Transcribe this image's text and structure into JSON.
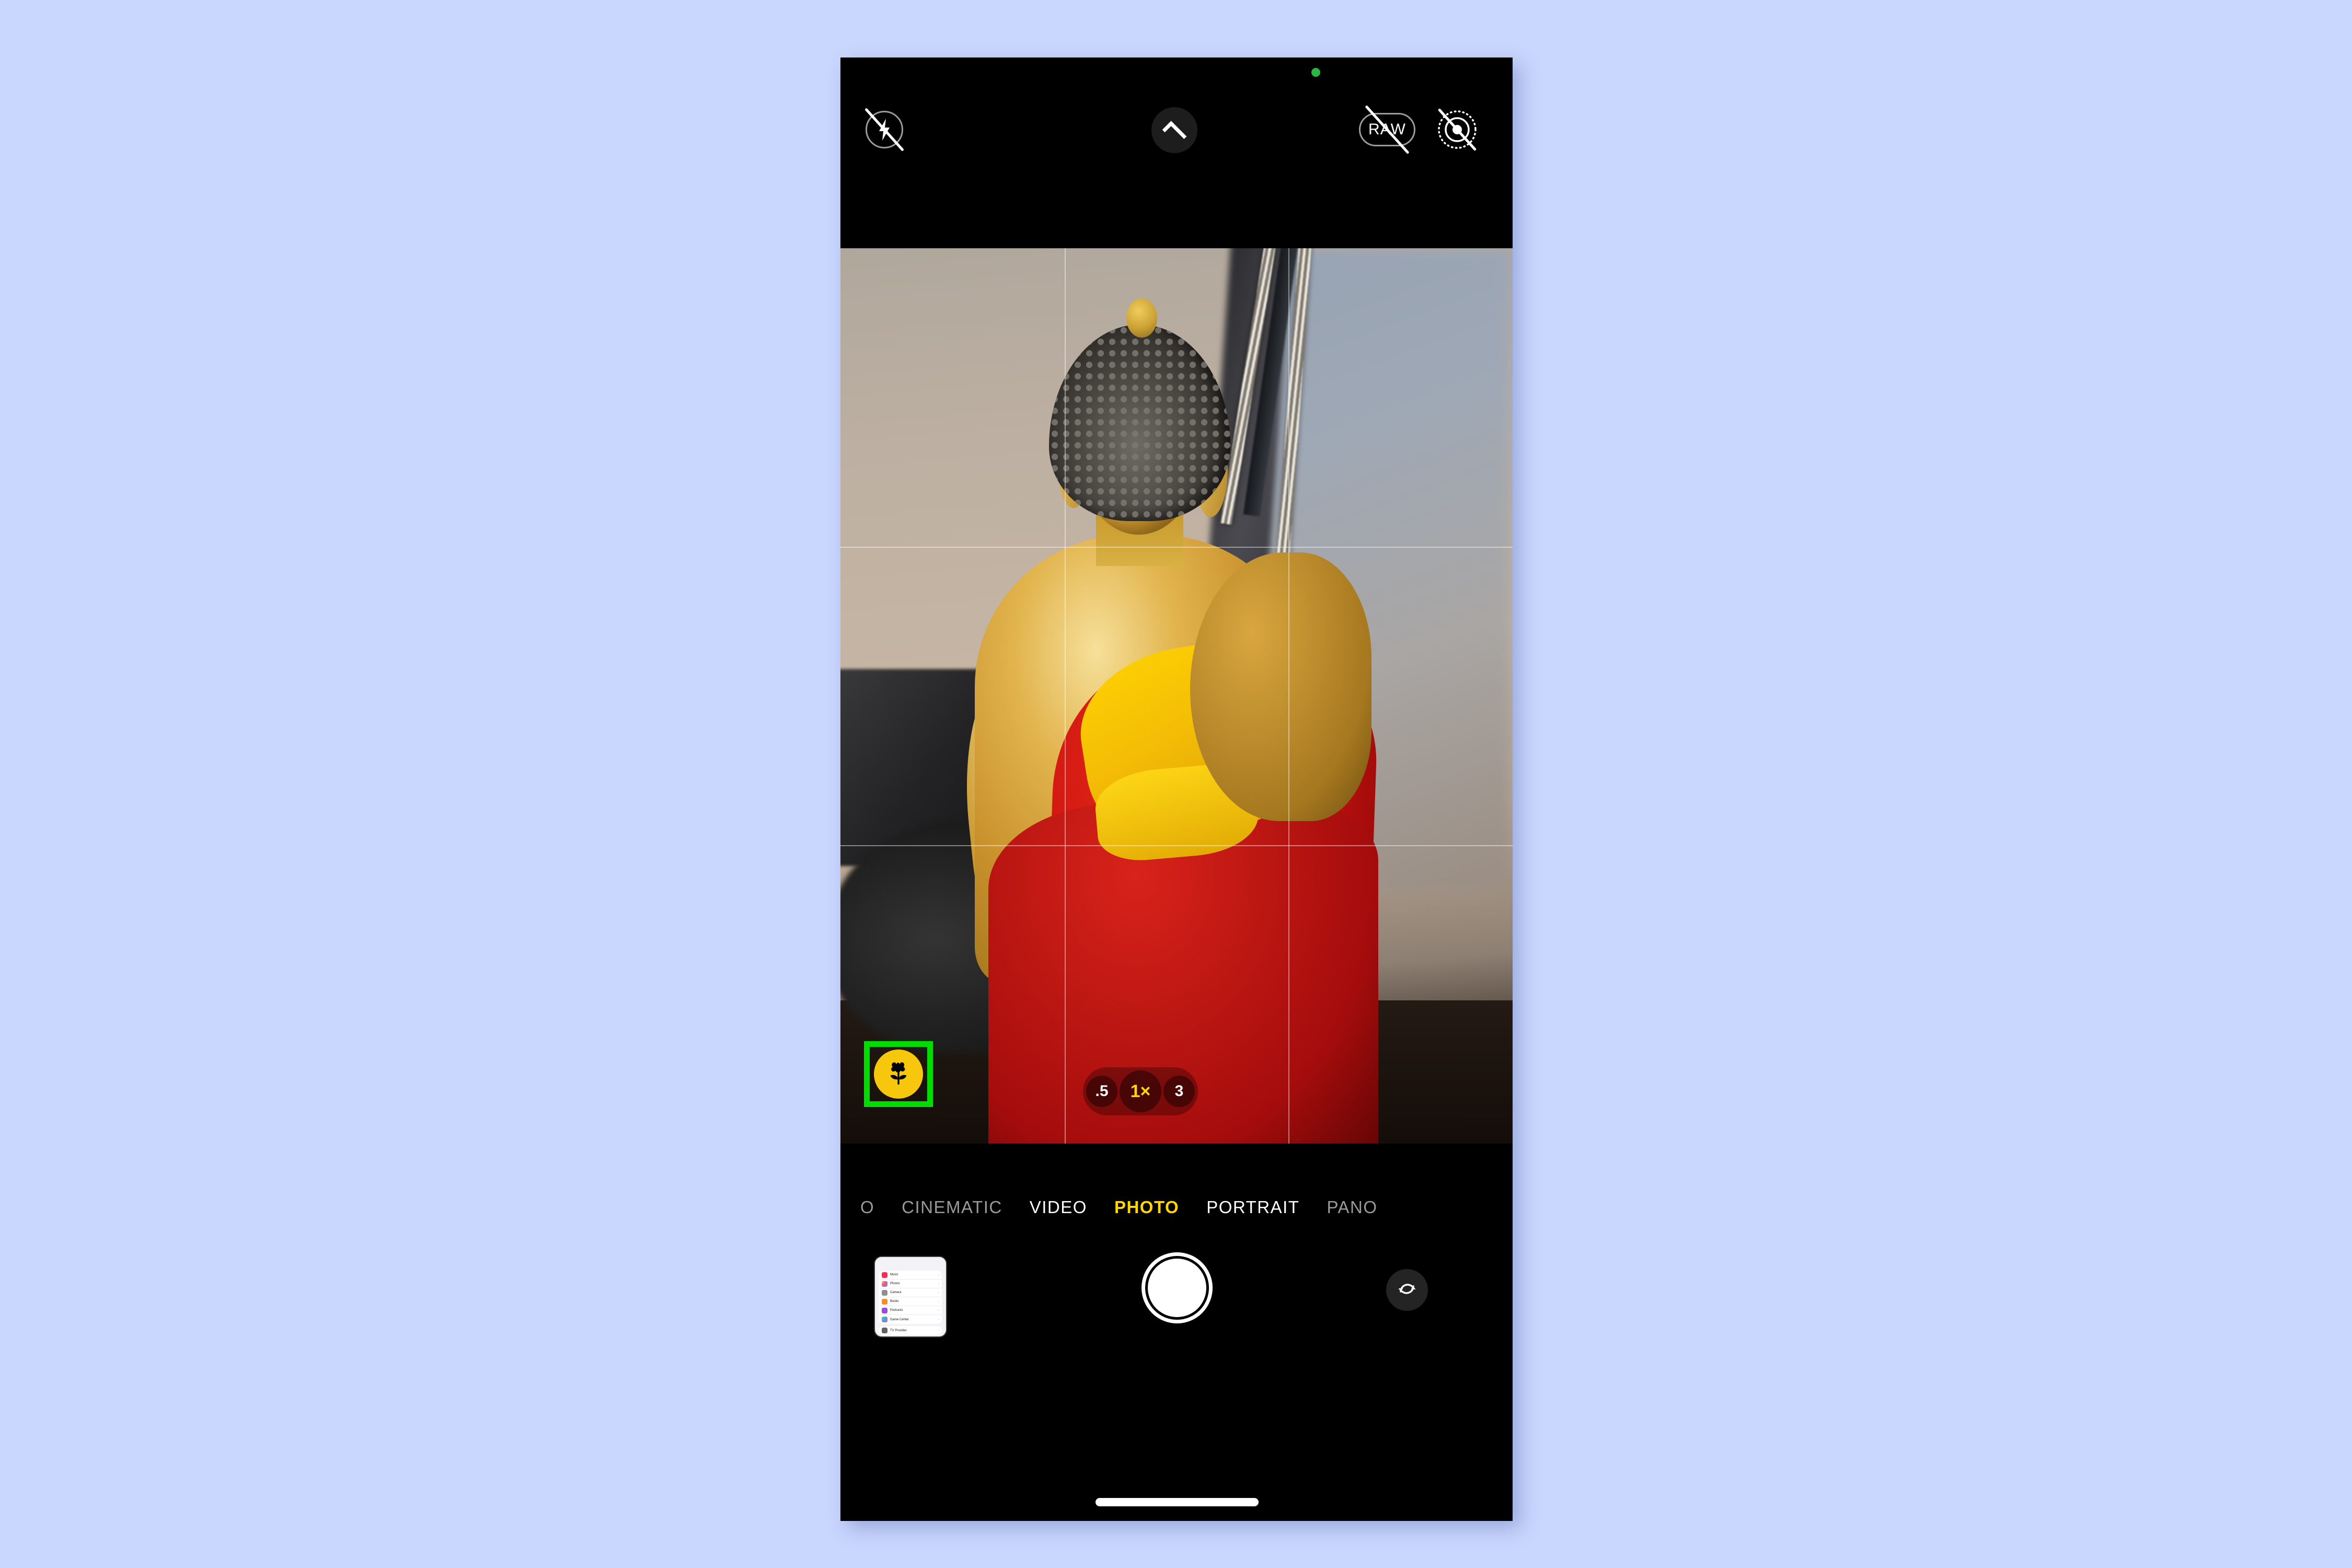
{
  "app": {
    "name": "Camera",
    "platform": "iOS"
  },
  "status": {
    "camera_in_use_indicator": "green-dot",
    "indicator_color": "#2cb742"
  },
  "top_controls": [
    {
      "name": "flash",
      "icon": "flash-off-icon",
      "label": "",
      "state": "off"
    },
    {
      "name": "more-options",
      "icon": "chevron-up-icon",
      "label": "",
      "state": "collapsed"
    },
    {
      "name": "raw",
      "icon": "raw-off-icon",
      "label": "RAW",
      "state": "off"
    },
    {
      "name": "live-photo",
      "icon": "live-photo-off-icon",
      "label": "",
      "state": "off"
    }
  ],
  "viewfinder": {
    "grid_enabled": true,
    "scene_description": "Golden Buddha statue in red and yellow robe, desk lamp behind",
    "macro_button": {
      "icon": "flower-icon",
      "label": "",
      "active": true,
      "bg_color": "#f7c70e",
      "highlight_color": "#00de00",
      "highlighted": true
    },
    "zoom_levels": [
      {
        "label": ".5",
        "active": false
      },
      {
        "label": "1×",
        "active": true
      },
      {
        "label": "3",
        "active": false
      }
    ],
    "active_zoom": "1×",
    "active_zoom_color": "#ffd60a"
  },
  "modes": [
    {
      "label": "O",
      "state": "clipped"
    },
    {
      "label": "CINEMATIC",
      "state": "inactive"
    },
    {
      "label": "VIDEO",
      "state": "inactive"
    },
    {
      "label": "PHOTO",
      "state": "active"
    },
    {
      "label": "PORTRAIT",
      "state": "inactive"
    },
    {
      "label": "PANO",
      "state": "inactive"
    }
  ],
  "active_mode": "PHOTO",
  "active_mode_color": "#ffd60a",
  "bottom_controls": {
    "thumbnail": {
      "name": "photo-library-thumbnail",
      "content_description": "iOS Settings screenshot",
      "rows": [
        {
          "label": "Music",
          "color": "#fb2c53"
        },
        {
          "label": "Photos",
          "color": "#f2c14e"
        },
        {
          "label": "Camera",
          "color": "#8e8e93"
        },
        {
          "label": "Books",
          "color": "#ff8c1a"
        },
        {
          "label": "Podcasts",
          "color": "#9b4bde"
        },
        {
          "label": "Game Center",
          "color": "#5ac8fa"
        }
      ],
      "rows2": [
        {
          "label": "TV Provider",
          "color": "#636366"
        }
      ],
      "chevron": "›"
    },
    "shutter": {
      "name": "shutter-button",
      "label": ""
    },
    "flip_camera": {
      "name": "flip-camera-button",
      "icon": "camera-flip-icon",
      "label": ""
    }
  },
  "home_indicator": {
    "visible": true
  },
  "colors": {
    "background": "#c9d6fd",
    "phone_body": "#000000",
    "accent_yellow": "#ffd60a",
    "highlight_green": "#00de00"
  }
}
